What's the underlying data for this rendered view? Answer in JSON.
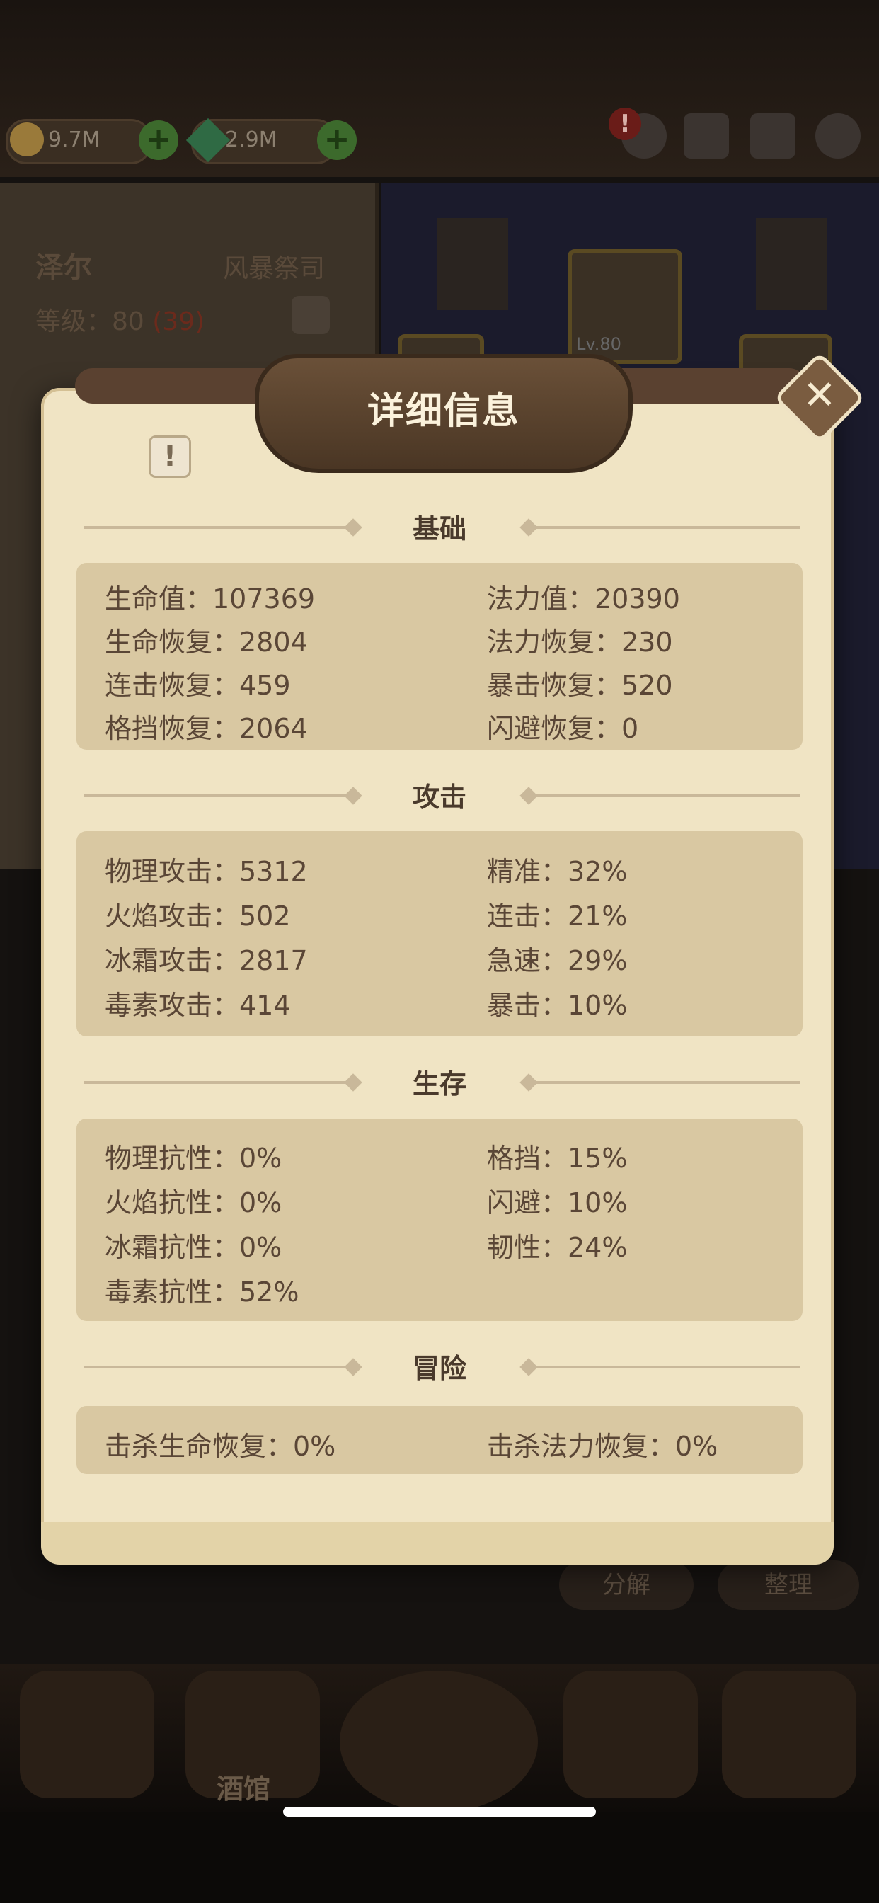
{
  "resources": {
    "gold": "9.7M",
    "gems": "2.9M"
  },
  "hero": {
    "name": "泽尔",
    "class": "风暴祭司",
    "level_label": "等级：80",
    "level_bonus": "(39)",
    "portrait_level": "Lv.80"
  },
  "dialog": {
    "title": "详细信息",
    "sections": {
      "basic": {
        "title": "基础",
        "stats": [
          "生命值：107369",
          "法力值：20390",
          "生命恢复：2804",
          "法力恢复：230",
          "连击恢复：459",
          "暴击恢复：520",
          "格挡恢复：2064",
          "闪避恢复：0"
        ]
      },
      "attack": {
        "title": "攻击",
        "stats": [
          "物理攻击：5312",
          "精准：32%",
          "火焰攻击：502",
          "连击：21%",
          "冰霜攻击：2817",
          "急速：29%",
          "毒素攻击：414",
          "暴击：10%"
        ]
      },
      "survival": {
        "title": "生存",
        "stats": [
          "物理抗性：0%",
          "格挡：15%",
          "火焰抗性：0%",
          "闪避：10%",
          "冰霜抗性：0%",
          "韧性：24%",
          "毒素抗性：52%"
        ]
      },
      "adventure": {
        "title": "冒险",
        "stats": [
          "击杀生命恢复：0%",
          "击杀法力恢复：0%"
        ]
      }
    }
  },
  "bottom": {
    "decompose_label": "分解",
    "sort_label": "整理",
    "tavern_label": "酒馆"
  },
  "colors": {
    "parchment": "#f0e4c4",
    "stat_box": "#d9c8a2",
    "text": "#5a4636",
    "plaque": "#5a4130"
  }
}
